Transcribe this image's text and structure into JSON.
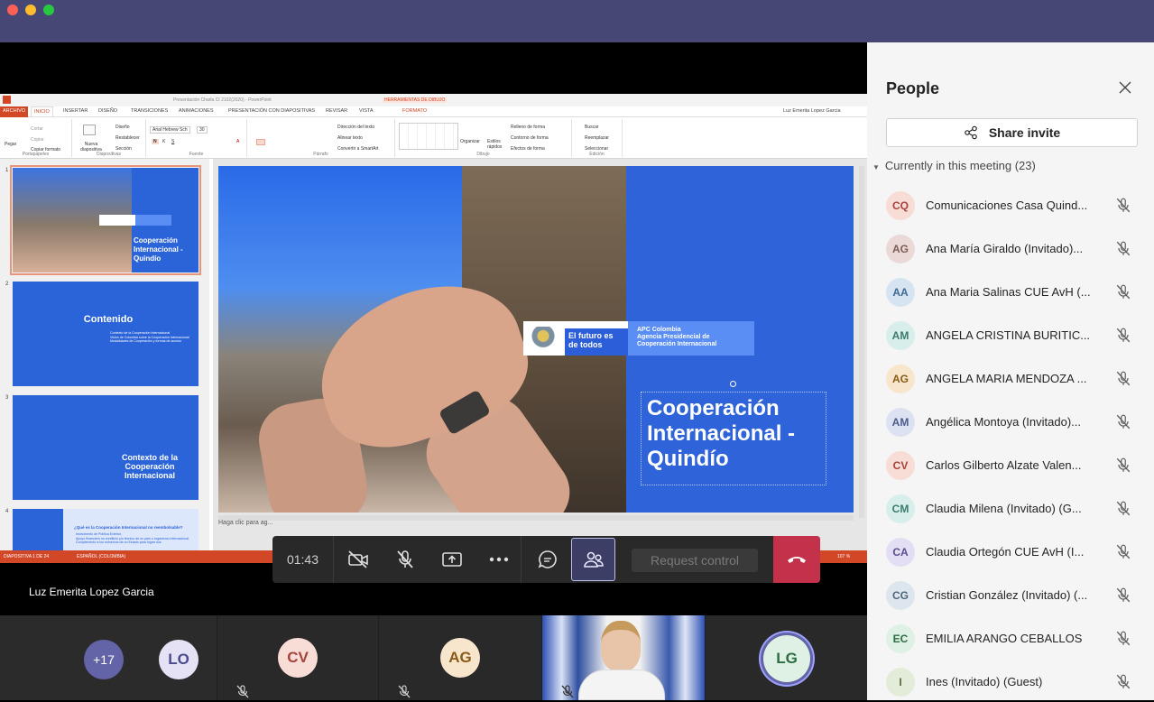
{
  "window": {
    "controls": [
      "close",
      "minimize",
      "zoom"
    ]
  },
  "ppt": {
    "title": "Presentación Charla CI 2102(2020) - PowerPoint",
    "tools_label": "HERRAMIENTAS DE DIBUJO",
    "user": "Luz Emerita Lopez Garcia",
    "tabs": [
      "ARCHIVO",
      "INICIO",
      "INSERTAR",
      "DISEÑO",
      "TRANSICIONES",
      "ANIMACIONES",
      "PRESENTACIÓN CON DIAPOSITIVAS",
      "REVISAR",
      "VISTA",
      "FORMATO"
    ],
    "ribbon": {
      "paste": "Pegar",
      "cut": "Cortar",
      "copy": "Copiar",
      "format_painter": "Copiar formato",
      "clipboard": "Portapapeles",
      "new_slide": "Nueva diapositiva",
      "layout": "Diseño",
      "reset": "Restablecer",
      "section": "Sección",
      "slides": "Diapositivas",
      "font_name": "Arial Hebrew Sch",
      "font_size": "30",
      "font": "Fuente",
      "text_dir": "Dirección del texto",
      "align_text": "Alinear texto",
      "smartart": "Convertir a SmartArt",
      "paragraph": "Párrafo",
      "arrange": "Organizar",
      "quick_styles": "Estilos rápidos",
      "fill": "Relleno de forma",
      "outline": "Contorno de forma",
      "effects": "Efectos de forma",
      "drawing": "Dibujo",
      "find": "Buscar",
      "replace": "Reemplazar",
      "select": "Seleccionar",
      "editing": "Edición"
    },
    "thumbnails": [
      {
        "num": "1",
        "text": "Cooperación Internacional - Quindío"
      },
      {
        "num": "2",
        "text": "Contenido",
        "items": [
          "Contexto de la Cooperación Internacional",
          "Visión de Colombia sobre la Cooperación Internacional",
          "Modalidades de Cooperación y formas de acceso"
        ]
      },
      {
        "num": "3",
        "text": "Contexto de la Cooperación Internacional"
      },
      {
        "num": "4",
        "text": "¿Qué es la Cooperación Internacional no reembolsable?",
        "items": [
          "Instrumento de Política Exterior.",
          "Apoyo financiero no crediticio y/o técnico de un país u organismo internacional.",
          "Complemento a los esfuerzos de un Estado para lograr sus"
        ]
      }
    ],
    "slide": {
      "logo_text": "El futuro es de todos",
      "apc_line1": "APC Colombia",
      "apc_line2": "Agencia Presidencial de",
      "apc_line3": "Cooperación Internacional",
      "title": "Cooperación Internacional - Quindío"
    },
    "notes": "Haga clic para ag...",
    "status_left": "DIAPOSITIVA 1 DE 24",
    "status_lang": "ESPAÑOL (COLOMBIA)",
    "zoom": "107 %"
  },
  "callbar": {
    "timer": "01:43",
    "request_control": "Request control"
  },
  "presenter_name": "Luz Emerita Lopez Garcia",
  "tiles": [
    {
      "label": "+17",
      "bg": "#6264a7",
      "fg": "#ffffff"
    },
    {
      "label": "LO",
      "bg": "#e6e2f5",
      "fg": "#4b4a8c"
    },
    {
      "label": "CV",
      "bg": "#f8dcd6",
      "fg": "#a5443a"
    },
    {
      "label": "AG",
      "bg": "#f7e6cc",
      "fg": "#8a5a17"
    },
    {
      "label": "LG",
      "bg": "#dff0e4",
      "fg": "#2d6b43"
    }
  ],
  "people": {
    "title": "People",
    "share_label": "Share invite",
    "section_label": "Currently in this meeting (23)",
    "list": [
      {
        "initials": "CQ",
        "name": "Comunicaciones Casa Quind...",
        "bg": "#f8dcd6",
        "fg": "#a5443a"
      },
      {
        "initials": "AG",
        "name": "Ana María Giraldo (Invitado)...",
        "bg": "#ead9d6",
        "fg": "#7d5d57"
      },
      {
        "initials": "AA",
        "name": "Ana Maria Salinas CUE AvH (...",
        "bg": "#d6e4f2",
        "fg": "#3d6a93"
      },
      {
        "initials": "AM",
        "name": "ANGELA CRISTINA BURITIC...",
        "bg": "#d7eeea",
        "fg": "#3b7a6e"
      },
      {
        "initials": "AG",
        "name": "ANGELA MARIA MENDOZA ...",
        "bg": "#f7e6cc",
        "fg": "#8a5a17"
      },
      {
        "initials": "AM",
        "name": "Angélica Montoya (Invitado)...",
        "bg": "#dde2f2",
        "fg": "#4a5a8c"
      },
      {
        "initials": "CV",
        "name": "Carlos Gilberto Alzate Valen...",
        "bg": "#f8dcd6",
        "fg": "#a5443a"
      },
      {
        "initials": "CM",
        "name": "Claudia Milena (Invitado) (G...",
        "bg": "#d7eeea",
        "fg": "#3b7a6e"
      },
      {
        "initials": "CA",
        "name": "Claudia Ortegón CUE AvH (I...",
        "bg": "#e3def4",
        "fg": "#5a4f8c"
      },
      {
        "initials": "CG",
        "name": "Cristian González (Invitado) (...",
        "bg": "#dde6ee",
        "fg": "#4d6678"
      },
      {
        "initials": "EC",
        "name": "EMILIA ARANGO CEBALLOS",
        "bg": "#dff0e4",
        "fg": "#2d6b43"
      },
      {
        "initials": "I",
        "name": "Ines (Invitado) (Guest)",
        "bg": "#e3ecd9",
        "fg": "#566b3b"
      }
    ]
  }
}
